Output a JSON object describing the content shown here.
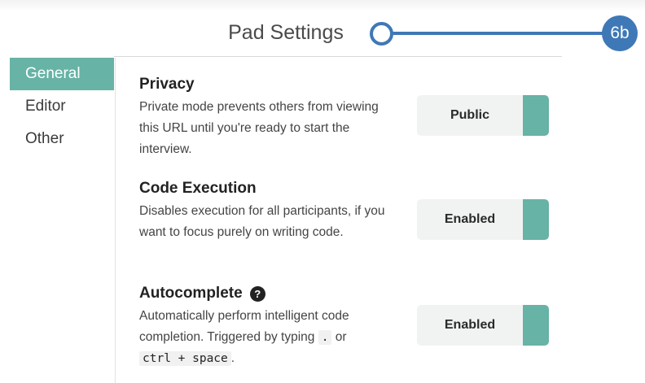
{
  "header": {
    "title": "Pad Settings",
    "callout_label": "6b"
  },
  "sidebar": {
    "items": [
      {
        "label": "General",
        "active": true
      },
      {
        "label": "Editor",
        "active": false
      },
      {
        "label": "Other",
        "active": false
      }
    ]
  },
  "settings": {
    "privacy": {
      "title": "Privacy",
      "description": "Private mode prevents others from viewing this URL until you're ready to start the interview.",
      "toggle_label": "Public"
    },
    "code_execution": {
      "title": "Code Execution",
      "description": "Disables execution for all participants, if you want to focus purely on writing code.",
      "toggle_label": "Enabled"
    },
    "autocomplete": {
      "title": "Autocomplete",
      "help_icon": "?",
      "description_pre": "Automatically perform intelligent code completion. Triggered by typing",
      "code_dot": ".",
      "description_or": "or",
      "code_shortcut": "ctrl + space",
      "description_end": ".",
      "toggle_label": "Enabled"
    }
  },
  "colors": {
    "accent": "#67b3a5",
    "callout": "#3f78b6"
  }
}
